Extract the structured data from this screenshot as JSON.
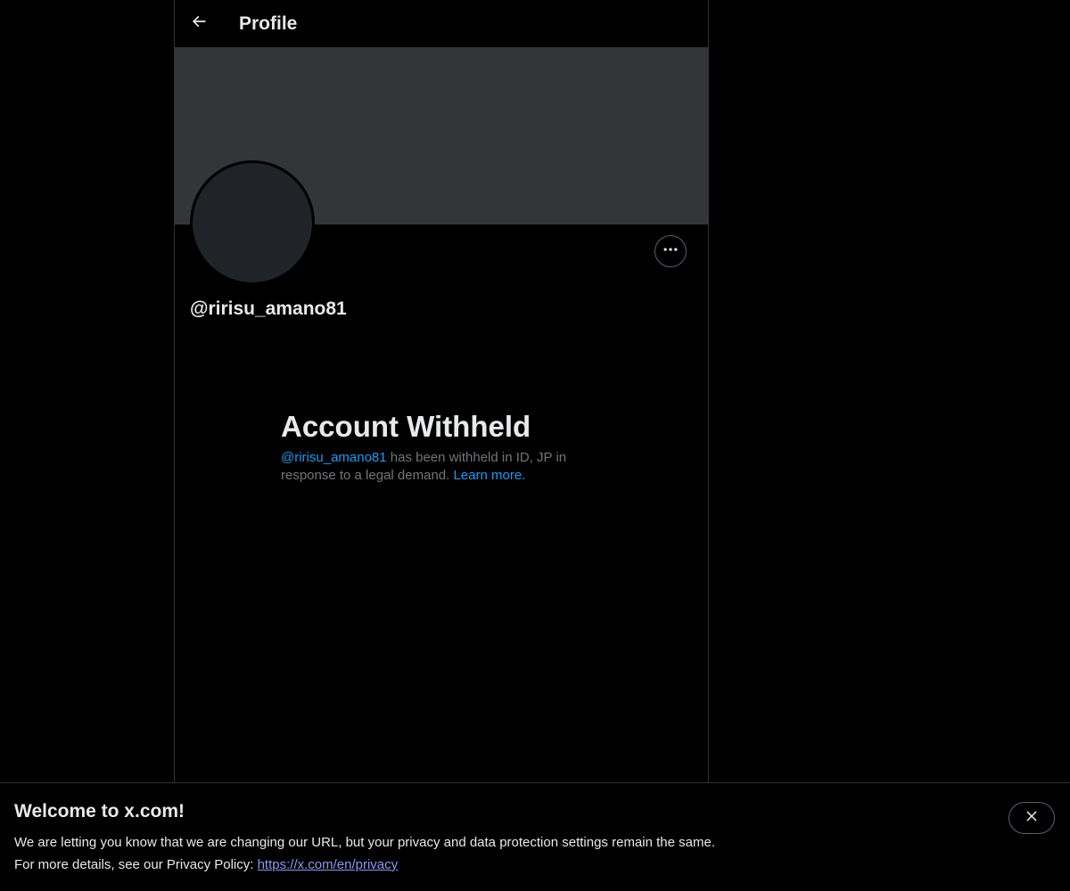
{
  "header": {
    "title": "Profile",
    "back_icon": "arrow-left-icon"
  },
  "profile": {
    "handle": "@ririsu_amano81",
    "more_icon": "ellipsis-icon"
  },
  "withheld": {
    "title": "Account Withheld",
    "handle_link": "@ririsu_amano81",
    "text_middle": " has been withheld in ID, JP in response to a legal demand. ",
    "learn_more": "Learn more."
  },
  "notice": {
    "title": "Welcome to x.com!",
    "line1": "We are letting you know that we are changing our URL, but your privacy and data protection settings remain the same.",
    "line2_prefix": "For more details, see our Privacy Policy: ",
    "privacy_link": "https://x.com/en/privacy",
    "close_icon": "close-icon"
  },
  "colors": {
    "background": "#000000",
    "banner": "#333639",
    "avatar": "#202327",
    "link": "#1d9bf0",
    "muted_text": "#71767b",
    "border": "#2f3336"
  }
}
